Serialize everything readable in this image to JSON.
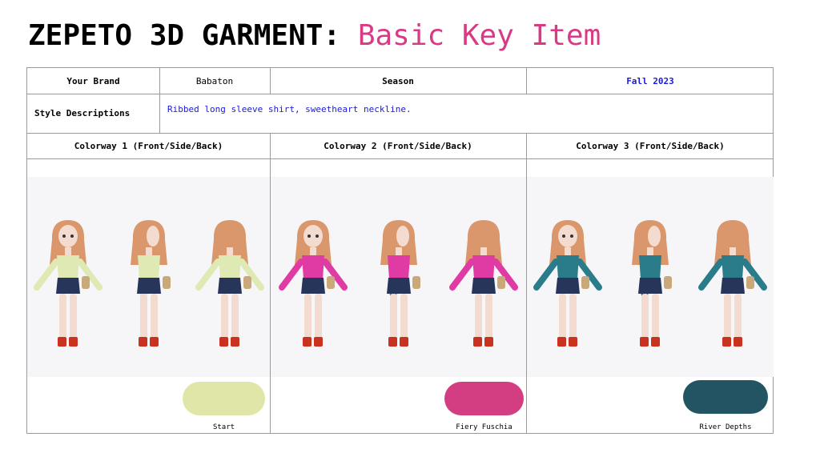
{
  "header": {
    "title_main": "ZEPETO 3D GARMENT: ",
    "title_accent": "Basic Key Item"
  },
  "table": {
    "brand_label": "Your Brand",
    "brand_value": "Babaton",
    "season_label": "Season",
    "season_value": "Fall 2023",
    "style_label": "Style Descriptions",
    "style_value": "Ribbed long sleeve shirt, sweetheart neckline.",
    "colorways": [
      {
        "header": "Colorway 1 (Front/Side/Back)",
        "swatch_name": "Start",
        "swatch_color": "#dfe6a8",
        "top_color": "#dfe9b3"
      },
      {
        "header": "Colorway 2 (Front/Side/Back)",
        "swatch_name": "Fiery Fuschia",
        "swatch_color": "#d33d81",
        "top_color": "#e03aa4"
      },
      {
        "header": "Colorway 3 (Front/Side/Back)",
        "swatch_name": "River Depths",
        "swatch_color": "#235463",
        "top_color": "#2a7c8a"
      }
    ]
  },
  "colors": {
    "title_accent": "#d93a85",
    "season_value": "#1a1ad6",
    "style_value": "#1a1ad6"
  },
  "figure_icons": [
    "avatar-front",
    "avatar-side",
    "avatar-back"
  ]
}
